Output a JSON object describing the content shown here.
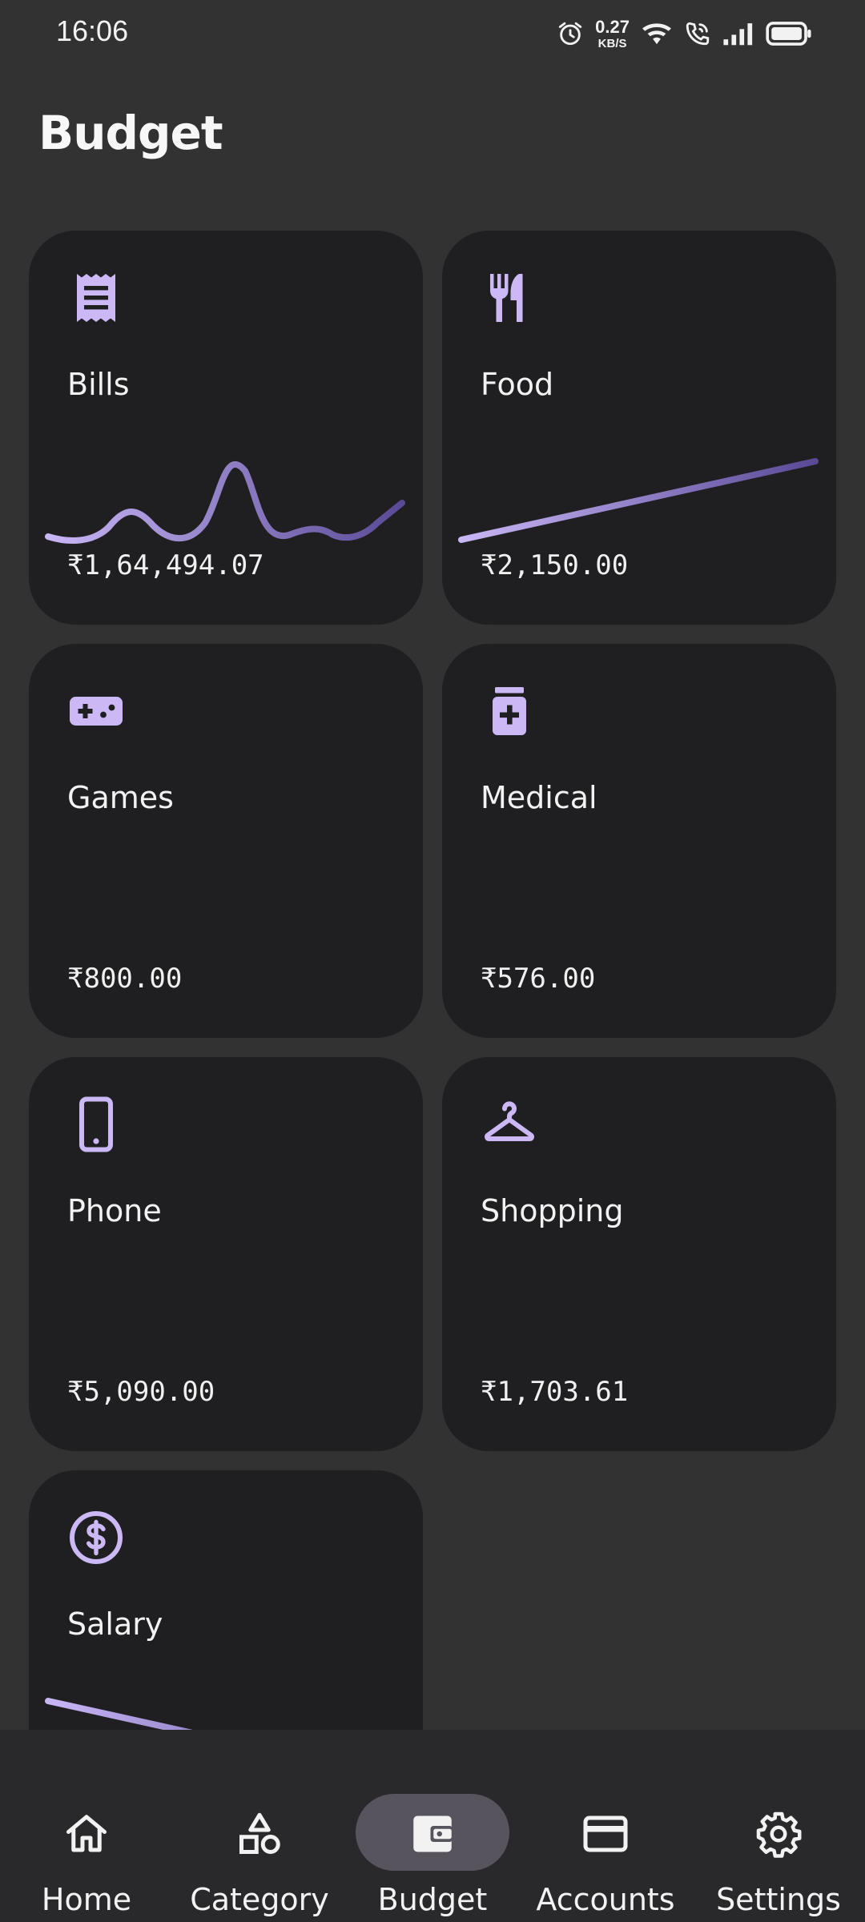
{
  "status_bar": {
    "time": "16:06",
    "net_speed_value": "0.27",
    "net_speed_unit": "KB/S",
    "icons": [
      "alarm-icon",
      "wifi-icon",
      "wifi-calling-icon",
      "signal-icon",
      "battery-icon"
    ]
  },
  "page": {
    "title": "Budget"
  },
  "colors": {
    "background": "#323232",
    "card": "#1f1f21",
    "accent": "#cbb8f5",
    "line_start": "#c9b6f6",
    "line_end": "#5a4a96",
    "nav_active": "#58545e"
  },
  "cards": [
    {
      "label": "Bills",
      "amount": "₹1,64,494.07",
      "icon": "receipt-icon",
      "trend": "wavy"
    },
    {
      "label": "Food",
      "amount": "₹2,150.00",
      "icon": "restaurant-icon",
      "trend": "rising"
    },
    {
      "label": "Games",
      "amount": "₹800.00",
      "icon": "gamepad-icon",
      "trend": "flat"
    },
    {
      "label": "Medical",
      "amount": "₹576.00",
      "icon": "medication-icon",
      "trend": "flat"
    },
    {
      "label": "Phone",
      "amount": "₹5,090.00",
      "icon": "smartphone-icon",
      "trend": "flat"
    },
    {
      "label": "Shopping",
      "amount": "₹1,703.61",
      "icon": "hanger-icon",
      "trend": "flat"
    },
    {
      "label": "Salary",
      "amount": "",
      "icon": "dollar-circle-icon",
      "trend": "falling"
    }
  ],
  "bottom_nav": {
    "items": [
      {
        "label": "Home",
        "icon": "home-icon",
        "active": false
      },
      {
        "label": "Category",
        "icon": "category-shapes-icon",
        "active": false
      },
      {
        "label": "Budget",
        "icon": "wallet-icon",
        "active": true
      },
      {
        "label": "Accounts",
        "icon": "credit-card-icon",
        "active": false
      },
      {
        "label": "Settings",
        "icon": "gear-icon",
        "active": false
      }
    ]
  }
}
